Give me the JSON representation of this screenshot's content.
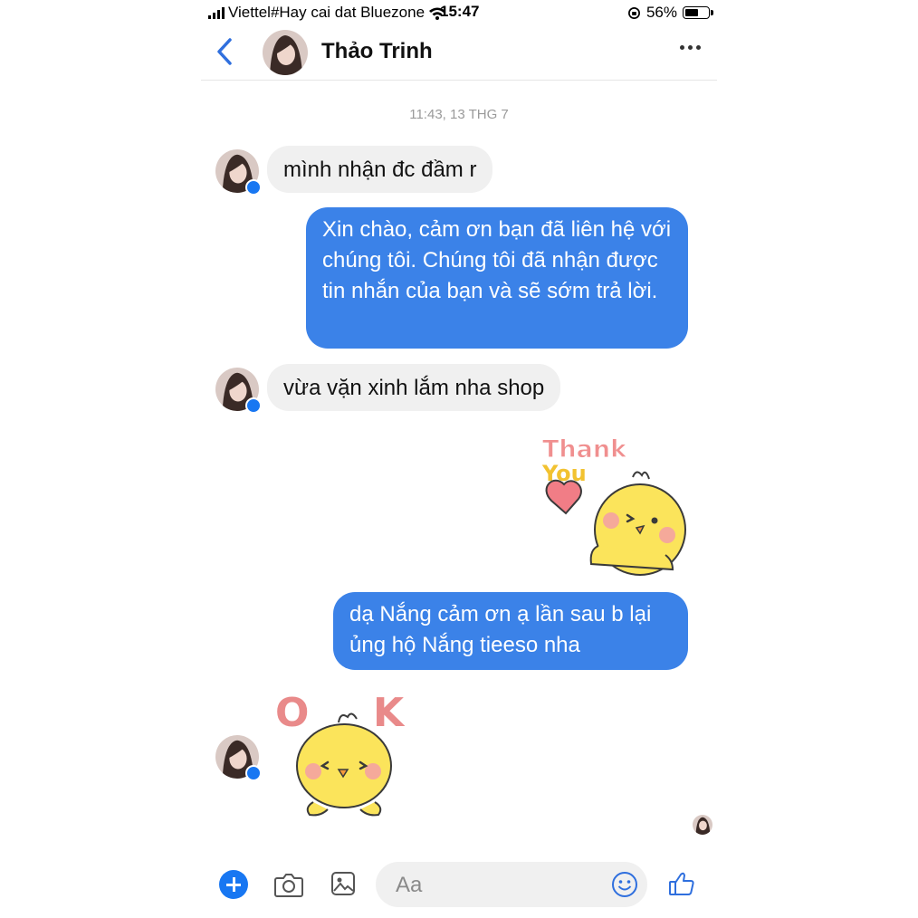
{
  "status_bar": {
    "carrier": "Viettel#Hay cai dat Bluezone",
    "time": "15:47",
    "battery_text": "56%",
    "battery_level": 0.56
  },
  "header": {
    "contact_name": "Thảo Trinh"
  },
  "conversation": {
    "timestamp": "11:43, 13 THG 7",
    "messages": [
      {
        "from": "contact",
        "text": "mình nhận đc đầm r"
      },
      {
        "from": "me",
        "text": "Xin chào, cảm ơn bạn đã liên hệ với chúng tôi. Chúng tôi đã nhận được tin nhắn của bạn và sẽ sớm trả lời."
      },
      {
        "from": "contact",
        "text": "vừa vặn xinh lắm nha shop"
      },
      {
        "from": "me",
        "sticker": "thank-you-chick-sticker",
        "text_line1": "Thank",
        "text_line2": "You"
      },
      {
        "from": "me",
        "text": "dạ Nắng cảm ơn ạ lần sau b lại ủng hộ Nắng tieeso nha"
      },
      {
        "from": "contact",
        "sticker": "ok-chick-sticker",
        "letter1": "O",
        "letter2": "K"
      }
    ]
  },
  "composer": {
    "placeholder": "Aa"
  },
  "colors": {
    "accent": "#1877f2",
    "outgoing_bubble": "#3b82e8",
    "incoming_bubble": "#f0f0f0"
  }
}
